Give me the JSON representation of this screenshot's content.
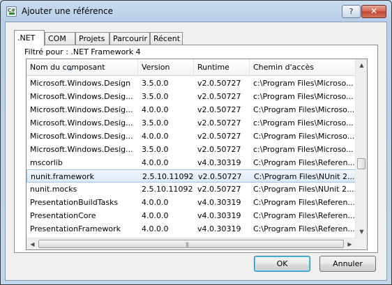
{
  "window": {
    "title": "Ajouter une référence",
    "icon_text": "C#",
    "help_label": "?",
    "close_label": "✕"
  },
  "tabs": [
    {
      "label": ".NET",
      "active": true
    },
    {
      "label": "COM",
      "active": false
    },
    {
      "label": "Projets",
      "active": false
    },
    {
      "label": "Parcourir",
      "active": false
    },
    {
      "label": "Récent",
      "active": false
    }
  ],
  "filter_label": "Filtré pour : .NET Framework 4",
  "columns": [
    "Nom du composant",
    "Version",
    "Runtime",
    "Chemin d'accès"
  ],
  "rows": [
    {
      "name": "Microsoft.Windows.Design",
      "version": "3.5.0.0",
      "runtime": "v2.0.50727",
      "path": "c:\\Program Files\\Microso..."
    },
    {
      "name": "Microsoft.Windows.Desig...",
      "version": "3.5.0.0",
      "runtime": "v2.0.50727",
      "path": "c:\\Program Files\\Microso..."
    },
    {
      "name": "Microsoft.Windows.Desig...",
      "version": "4.0.0.0",
      "runtime": "v2.0.50727",
      "path": "C:\\Program Files\\Microso..."
    },
    {
      "name": "Microsoft.Windows.Desig...",
      "version": "3.5.0.0",
      "runtime": "v2.0.50727",
      "path": "c:\\Program Files\\Microso..."
    },
    {
      "name": "Microsoft.Windows.Desig...",
      "version": "4.0.0.0",
      "runtime": "v2.0.50727",
      "path": "C:\\Program Files\\Microso..."
    },
    {
      "name": "Microsoft.Windows.Desig...",
      "version": "3.5.0.0",
      "runtime": "v2.0.50727",
      "path": "c:\\Program Files\\Microso..."
    },
    {
      "name": "mscorlib",
      "version": "4.0.0.0",
      "runtime": "v4.0.30319",
      "path": "C:\\Program Files\\Referen..."
    },
    {
      "name": "nunit.framework",
      "version": "2.5.10.11092",
      "runtime": "v2.0.50727",
      "path": "C:\\Program Files\\NUnit 2....",
      "selected": true
    },
    {
      "name": "nunit.mocks",
      "version": "2.5.10.11092",
      "runtime": "v2.0.50727",
      "path": "C:\\Program Files\\NUnit 2...."
    },
    {
      "name": "PresentationBuildTasks",
      "version": "4.0.0.0",
      "runtime": "v4.0.30319",
      "path": "C:\\Program Files\\Referen..."
    },
    {
      "name": "PresentationCore",
      "version": "4.0.0.0",
      "runtime": "v4.0.30319",
      "path": "C:\\Program Files\\Referen..."
    },
    {
      "name": "PresentationFramework",
      "version": "4.0.0.0",
      "runtime": "v4.0.30319",
      "path": "C:\\Program Files\\Referen..."
    }
  ],
  "buttons": {
    "ok": "OK",
    "cancel": "Annuler"
  }
}
